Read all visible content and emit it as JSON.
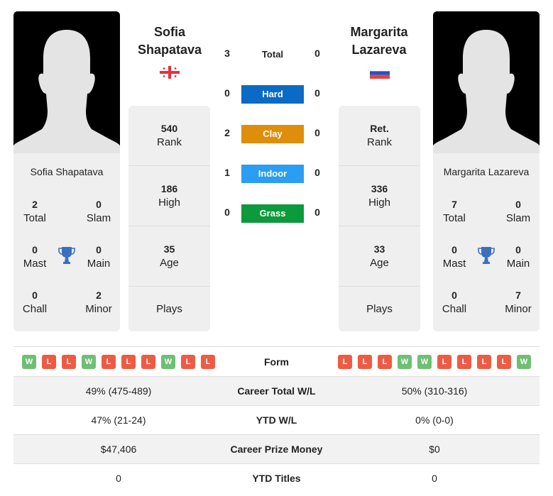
{
  "colors": {
    "hard": "#0a6ac4",
    "clay": "#de8e0a",
    "indoor": "#2b9df3",
    "grass": "#0d9a3c",
    "win": "#6fbf73",
    "loss": "#ee5b45",
    "trophy": "#3d6fbf"
  },
  "player1": {
    "name_line1": "Sofia",
    "name_line2": "Shapatava",
    "full_name": "Sofia Shapatava",
    "flag_icon": "georgia-flag-icon",
    "titles": {
      "total": {
        "value": "2",
        "label": "Total"
      },
      "slam": {
        "value": "0",
        "label": "Slam"
      },
      "mast": {
        "value": "0",
        "label": "Mast"
      },
      "main": {
        "value": "0",
        "label": "Main"
      },
      "chall": {
        "value": "0",
        "label": "Chall"
      },
      "minor": {
        "value": "2",
        "label": "Minor"
      }
    },
    "stats": {
      "rank": {
        "value": "540",
        "label": "Rank"
      },
      "high": {
        "value": "186",
        "label": "High"
      },
      "age": {
        "value": "35",
        "label": "Age"
      },
      "plays": {
        "value": "",
        "label": "Plays"
      }
    },
    "form": [
      "W",
      "L",
      "L",
      "W",
      "L",
      "L",
      "L",
      "W",
      "L",
      "L"
    ]
  },
  "player2": {
    "name_line1": "Margarita",
    "name_line2": "Lazareva",
    "full_name": "Margarita Lazareva",
    "flag_icon": "russia-flag-icon",
    "titles": {
      "total": {
        "value": "7",
        "label": "Total"
      },
      "slam": {
        "value": "0",
        "label": "Slam"
      },
      "mast": {
        "value": "0",
        "label": "Mast"
      },
      "main": {
        "value": "0",
        "label": "Main"
      },
      "chall": {
        "value": "0",
        "label": "Chall"
      },
      "minor": {
        "value": "7",
        "label": "Minor"
      }
    },
    "stats": {
      "rank": {
        "value": "Ret.",
        "label": "Rank"
      },
      "high": {
        "value": "336",
        "label": "High"
      },
      "age": {
        "value": "33",
        "label": "Age"
      },
      "plays": {
        "value": "",
        "label": "Plays"
      }
    },
    "form": [
      "L",
      "L",
      "L",
      "W",
      "W",
      "L",
      "L",
      "L",
      "L",
      "W"
    ]
  },
  "h2h": {
    "total": {
      "label": "Total",
      "p1": "3",
      "p2": "0"
    },
    "surfaces": [
      {
        "label": "Hard",
        "p1": "0",
        "p2": "0",
        "color": "#0a6ac4"
      },
      {
        "label": "Clay",
        "p1": "2",
        "p2": "0",
        "color": "#de8e0a"
      },
      {
        "label": "Indoor",
        "p1": "1",
        "p2": "0",
        "color": "#2b9df3"
      },
      {
        "label": "Grass",
        "p1": "0",
        "p2": "0",
        "color": "#0d9a3c"
      }
    ]
  },
  "comparison": {
    "form_label": "Form",
    "rows": [
      {
        "label": "Career Total W/L",
        "p1": "49% (475-489)",
        "p2": "50% (310-316)"
      },
      {
        "label": "YTD W/L",
        "p1": "47% (21-24)",
        "p2": "0% (0-0)"
      },
      {
        "label": "Career Prize Money",
        "p1": "$47,406",
        "p2": "$0"
      },
      {
        "label": "YTD Titles",
        "p1": "0",
        "p2": "0"
      }
    ]
  }
}
